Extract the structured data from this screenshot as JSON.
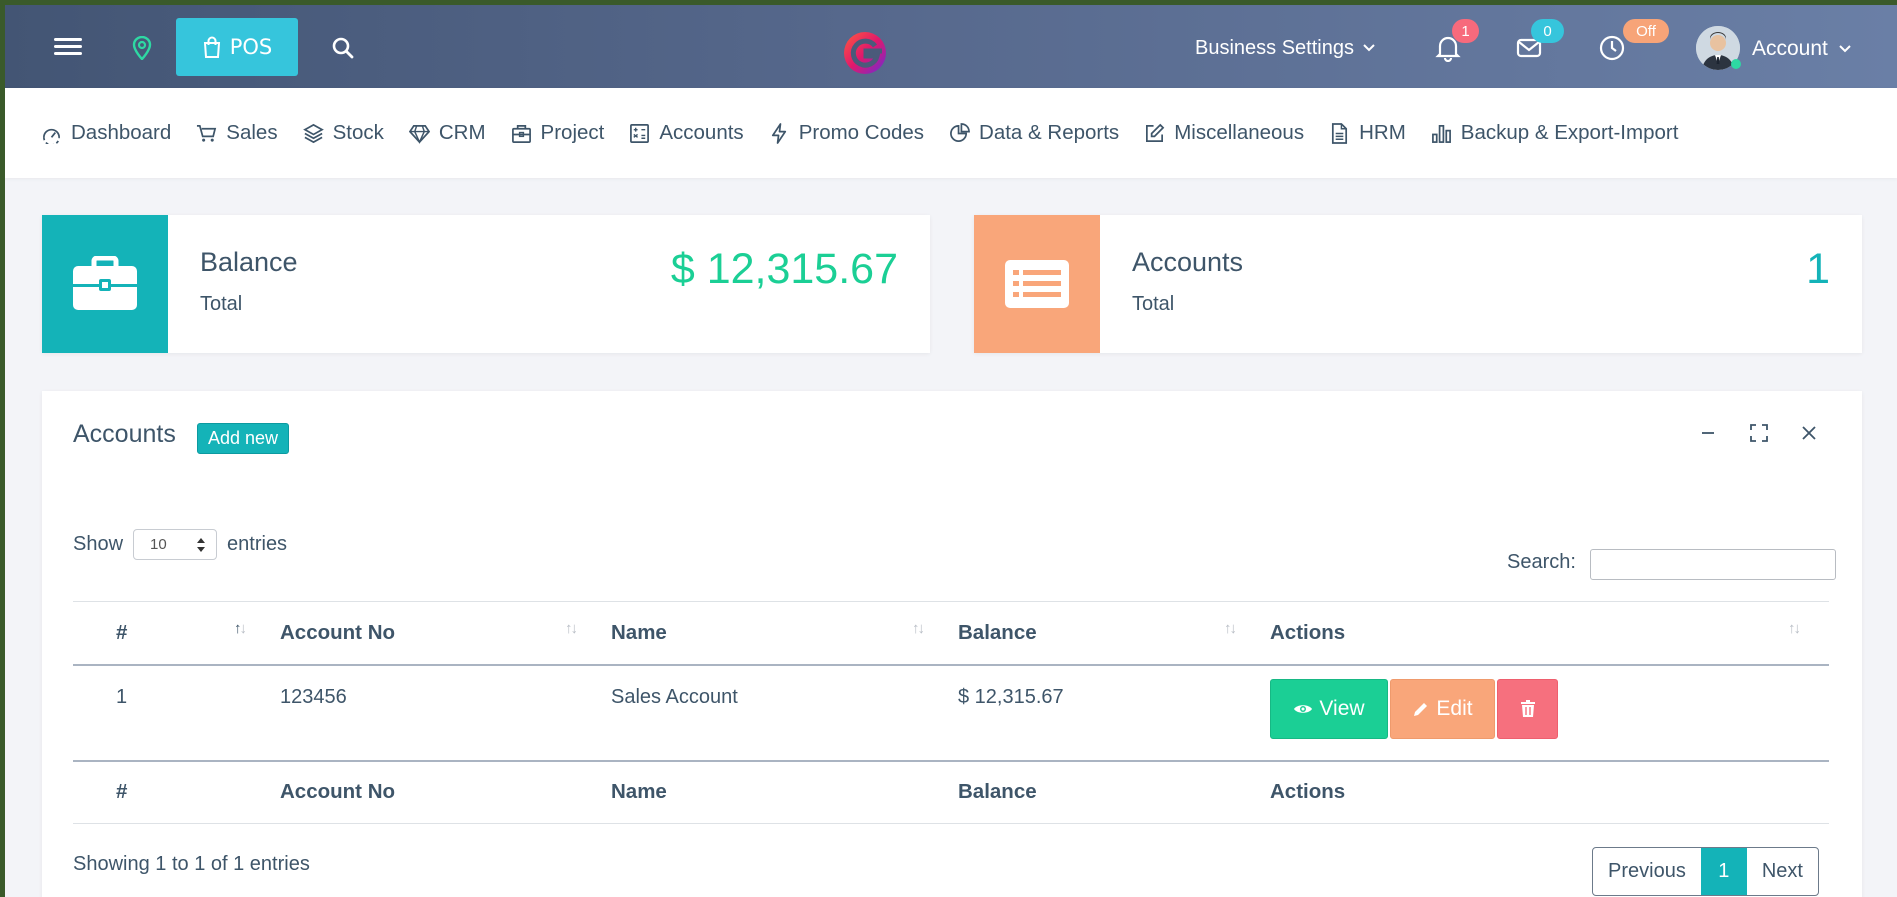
{
  "topbar": {
    "pos_label": "POS",
    "business_settings": "Business Settings",
    "notification_count": "1",
    "message_count": "0",
    "clock_status": "Off",
    "account_label": "Account"
  },
  "menu": [
    {
      "label": "Dashboard",
      "icon": "dashboard-icon"
    },
    {
      "label": "Sales",
      "icon": "cart-icon"
    },
    {
      "label": "Stock",
      "icon": "layers-icon"
    },
    {
      "label": "CRM",
      "icon": "diamond-icon"
    },
    {
      "label": "Project",
      "icon": "briefcase-icon"
    },
    {
      "label": "Accounts",
      "icon": "calculator-icon"
    },
    {
      "label": "Promo Codes",
      "icon": "bolt-icon"
    },
    {
      "label": "Data & Reports",
      "icon": "pie-chart-icon"
    },
    {
      "label": "Miscellaneous",
      "icon": "edit-icon"
    },
    {
      "label": "HRM",
      "icon": "document-icon"
    },
    {
      "label": "Backup & Export-Import",
      "icon": "bar-chart-icon"
    }
  ],
  "cards": {
    "balance": {
      "title": "Balance",
      "sub": "Total",
      "value": "$ 12,315.67",
      "color": "#14b3b8",
      "value_color": "#1bcf95"
    },
    "accounts": {
      "title": "Accounts",
      "sub": "Total",
      "value": "1",
      "color": "#f9a67a",
      "value_color": "#14b3b8"
    }
  },
  "panel": {
    "title": "Accounts",
    "add_new": "Add new",
    "show_label": "Show",
    "entries_label": "entries",
    "page_length": "10",
    "search_label": "Search:",
    "search_value": "",
    "columns": [
      "#",
      "Account No",
      "Name",
      "Balance",
      "Actions"
    ],
    "rows": [
      {
        "index": "1",
        "account_no": "123456",
        "name": "Sales Account",
        "balance": "$ 12,315.67"
      }
    ],
    "view_label": "View",
    "edit_label": "Edit",
    "info": "Showing 1 to 1 of 1 entries",
    "pager": {
      "previous": "Previous",
      "current": "1",
      "next": "Next"
    }
  }
}
